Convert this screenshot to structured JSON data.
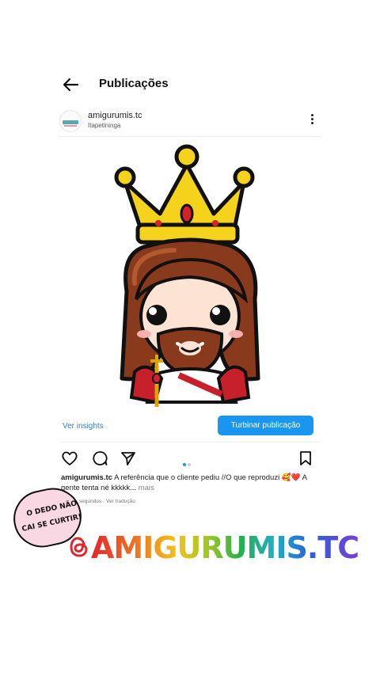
{
  "header": {
    "title": "Publicações"
  },
  "post": {
    "username": "amigurumis.tc",
    "location": "Itapetininga",
    "insights_label": "Ver insights",
    "boost_label": "Turbinar publicação",
    "caption_user": "amigurumis.tc",
    "caption_text": "A referência que o cliente pediu //O que reproduzi 🥰❤️ A gente tenta né kkkkk...",
    "caption_more": "mais",
    "meta": "segundos · Ver tradução",
    "carousel": {
      "count": 2,
      "active": 1
    }
  },
  "overlay": {
    "sticker_line1": "O DEDO NÃO",
    "sticker_line2": "CAI SE CURTIR!",
    "handle": "AMIGURUMIS.TC",
    "handle_icon": "threads-icon"
  },
  "colors": {
    "accent": "#1896f0",
    "link": "#3a7fc1"
  }
}
